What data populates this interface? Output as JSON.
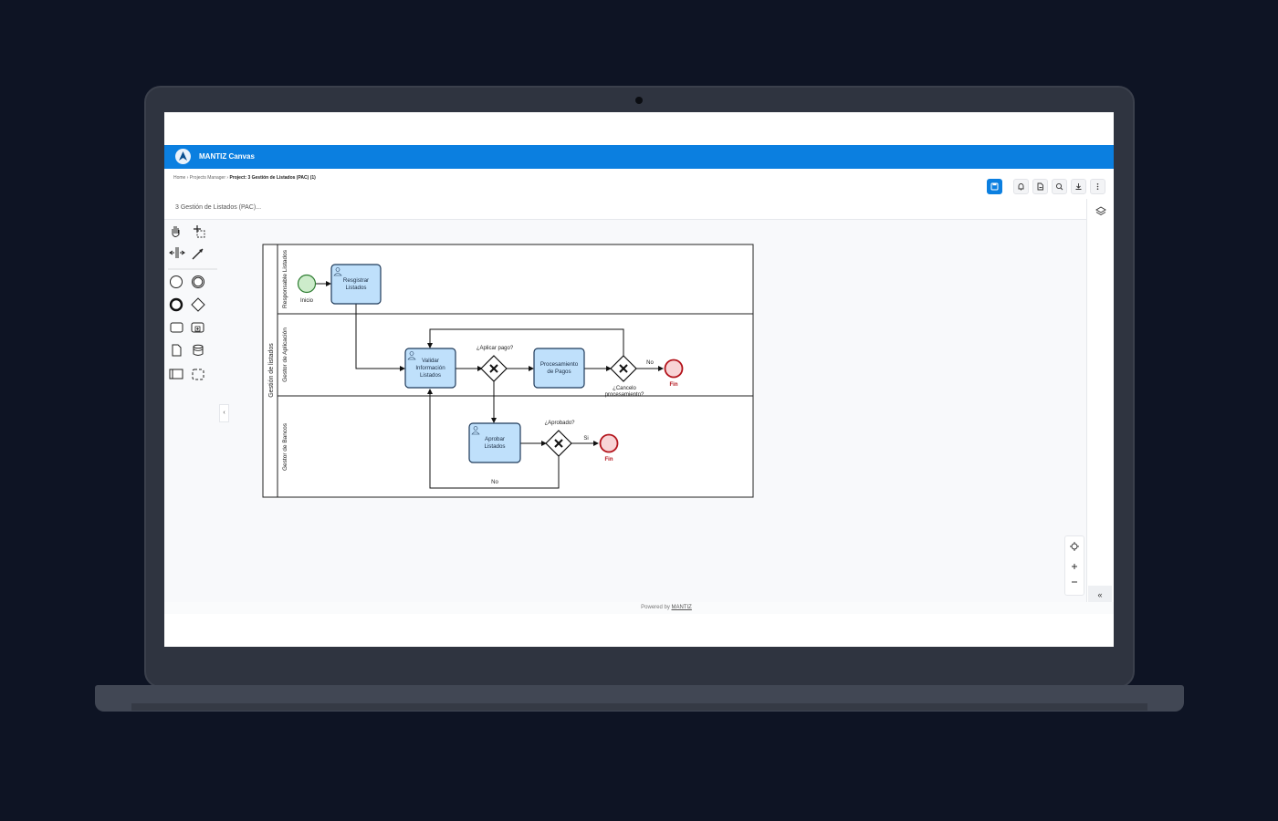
{
  "app": {
    "title": "MANTIZ Canvas"
  },
  "breadcrumb": {
    "items": [
      "Home",
      "Projects Manager"
    ],
    "current": "Project: 3 Gestión de Listados (PAC) (1)",
    "separator": "›"
  },
  "document": {
    "title": "3 Gestión de Listados (PAC)..."
  },
  "toolbar": {
    "buttons": [
      "save-icon",
      "bell-icon",
      "file-export-icon",
      "search-icon",
      "download-icon",
      "more-vertical-icon"
    ],
    "accent": "#0b7fe0"
  },
  "palette": {
    "tools": [
      "hand-tool-icon",
      "lasso-tool-icon",
      "space-tool-icon",
      "connect-tool-icon",
      "start-event-icon",
      "intermediate-event-icon",
      "end-event-icon",
      "gateway-icon",
      "task-icon",
      "subprocess-icon",
      "data-object-icon",
      "data-store-icon",
      "pool-icon",
      "group-icon"
    ]
  },
  "diagram": {
    "pool": "Gestión de listados",
    "lanes": [
      "Responsable Listados",
      "Gestor de Aplicación",
      "Gestor de Bancos"
    ],
    "tasks": {
      "registrar": [
        "Resgistrar",
        "Listados"
      ],
      "validar": [
        "Validar",
        "Información",
        "Listados"
      ],
      "procesamiento": [
        "Procesamiento",
        "de Pagos"
      ],
      "aprobar": [
        "Aprobar",
        "Listados"
      ]
    },
    "events": {
      "start": "Inicio",
      "end1": "Fin",
      "end2": "Fin"
    },
    "gateways": {
      "aplicar": "¿Aplicar pago?",
      "cancelo": [
        "¿Cancelo",
        "procesamiento?"
      ],
      "aprobado": "¿Aprobado?"
    },
    "flow_labels": {
      "no1": "No",
      "si": "Si",
      "no2": "No"
    },
    "colors": {
      "task_fill": "#bfe0fb",
      "task_stroke": "#1f3a5a",
      "start_fill": "#cdeccb",
      "start_stroke": "#2e7d32",
      "end_fill": "#f8d4d6",
      "end_stroke": "#b3131b"
    }
  },
  "zoom": {
    "controls": [
      "recenter-icon",
      "zoom-in-icon",
      "zoom-out-icon"
    ]
  },
  "panel": {
    "collapse_label": "«"
  },
  "footer": {
    "prefix": "Powered by",
    "brand": "MANTIZ"
  }
}
